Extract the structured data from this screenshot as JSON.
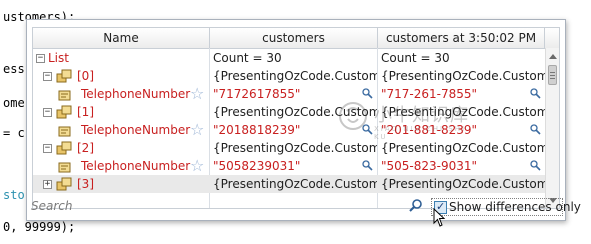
{
  "editor": {
    "lines": [
      "ustomers);",
      "ess",
      "ome",
      "= c",
      "sto",
      "0, 99999);"
    ]
  },
  "watch": {
    "columns": [
      "Name",
      "customers",
      "customers at 3:50:02 PM"
    ],
    "rows": [
      {
        "name": "List",
        "val1": "Count = 30",
        "val2": "Count = 30"
      },
      {
        "name": "[0]",
        "val1": "{PresentingOzCode.Customer}",
        "val2": "{PresentingOzCode.Customer}"
      },
      {
        "name": "TelephoneNumber",
        "val1": "\"7172617855\"",
        "val2": "\"717-261-7855\""
      },
      {
        "name": "[1]",
        "val1": "{PresentingOzCode.Customer}",
        "val2": "{PresentingOzCode.Customer}"
      },
      {
        "name": "TelephoneNumber",
        "val1": "\"2018818239\"",
        "val2": "\"201-881-8239\""
      },
      {
        "name": "[2]",
        "val1": "{PresentingOzCode.Customer}",
        "val2": "{PresentingOzCode.Customer}"
      },
      {
        "name": "TelephoneNumber",
        "val1": "\"5058239031\"",
        "val2": "\"505-823-9031\""
      },
      {
        "name": "[3]",
        "val1": "{PresentingOzCode.Customer}",
        "val2": "{PresentingOzCode.Customer}"
      }
    ],
    "search_placeholder": "Search",
    "show_differences_label": "Show differences only",
    "show_differences_checked": true
  },
  "watermark": {
    "text": "小牛知识库",
    "sub": "XIAO NIU ZHI SHI KU"
  },
  "colors": {
    "changed_text": "#c82020",
    "accent": "#3c7fb1"
  }
}
